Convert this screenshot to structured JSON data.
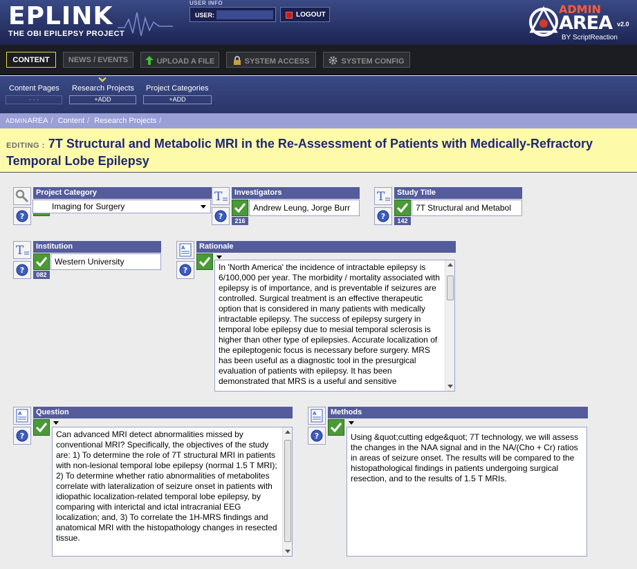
{
  "header": {
    "logo_main": "EPLINK",
    "logo_sub": "THE OBI EPILEPSY PROJECT",
    "user_info_caption": "USER INFO",
    "user_label": "USER:",
    "logout_label": "LOGOUT",
    "admin_logo_top": "ADMIN",
    "admin_logo_main": "AREA",
    "admin_logo_version": "v2.0",
    "admin_logo_by": "BY ScriptReaction"
  },
  "main_nav": {
    "items": [
      {
        "label": "CONTENT",
        "icon": "none",
        "active": true
      },
      {
        "label": "NEWS / EVENTS",
        "icon": "none",
        "active": false
      },
      {
        "label": "UPLOAD A FILE",
        "icon": "upload-arrow-icon",
        "active": false
      },
      {
        "label": "SYSTEM ACCESS",
        "icon": "lock-icon",
        "active": false
      },
      {
        "label": "SYSTEM CONFIG",
        "icon": "gear-icon",
        "active": false
      }
    ]
  },
  "sub_nav": {
    "items": [
      {
        "label": "Content Pages",
        "action": "- - -"
      },
      {
        "label": "Research Projects",
        "action": "+ADD"
      },
      {
        "label": "Project Categories",
        "action": "+ADD"
      }
    ]
  },
  "breadcrumb": {
    "brand_small": "ADMIN",
    "brand_big": "AREA",
    "items": [
      "Content",
      "Research Projects"
    ]
  },
  "editing": {
    "label": "EDITING :",
    "title": "7T Structural and Metabolic MRI in the Re-Assessment of Patients with Medically-Refractory Temporal Lobe Epilepsy"
  },
  "fields": {
    "project_category": {
      "label": "Project Category",
      "value": "Imaging for Surgery",
      "icon": "wrench-icon"
    },
    "investigators": {
      "label": "Investigators",
      "value": "Andrew Leung, Jorge Burr",
      "count": "216",
      "icon": "text-field-icon"
    },
    "study_title": {
      "label": "Study Title",
      "value": "7T Structural and Metabol",
      "count": "142",
      "icon": "text-field-icon"
    },
    "institution": {
      "label": "Institution",
      "value": "Western University",
      "count": "082",
      "icon": "text-field-icon"
    },
    "rationale": {
      "label": "Rationale",
      "icon": "text-area-icon",
      "value": "In 'North America' the incidence of intractable epilepsy is 6/100,000 per year. The morbidity / mortality associated with epilepsy is of importance, and is preventable if seizures are controlled. Surgical treatment is an effective therapeutic option that is considered in many patients with medically intractable epilepsy. The success of epilepsy surgery in temporal lobe epilepsy due to mesial temporal sclerosis is higher than other type of epilepsies. Accurate localization of the epileptogenic focus is necessary before surgery. MRS has been useful as a diagnostic tool in the presurgical evaluation of patients with epilepsy. It has been demonstrated that MRS is a useful and sensitive"
    },
    "question": {
      "label": "Question",
      "icon": "text-area-icon",
      "value": "Can advanced MRI detect abnormalities missed by conventional MRI? Specifically, the objectives of the study are: 1) To determine the role of 7T structural MRI in patients with non-lesional temporal lobe epilepsy (normal 1.5 T MRI); 2) To determine whether ratio abnormalities of metabolites correlate with lateralization of seizure onset in patients with idiopathic localization-related temporal lobe epilepsy, by comparing with interictal and ictal intracranial EEG localization; and, 3) To correlate the 1H-MRS findings and anatomical MRI with the histopathology changes in resected tissue."
    },
    "methods": {
      "label": "Methods",
      "icon": "text-area-icon",
      "value": "Using &quot;cutting edge&quot; 7T technology, we will assess the changes in the NAA signal and in the NA/(Cho + Cr) ratios in areas of seizure onset. The results will be compared to the histopathological findings in patients undergoing surgical resection, and to the results of 1.5 T MRIs."
    }
  },
  "colors": {
    "header_bg": "#2a3567",
    "field_header": "#545c9c",
    "check_green": "#4a9a38",
    "title_bg": "#fdfaa9",
    "title_text": "#1f2778"
  }
}
